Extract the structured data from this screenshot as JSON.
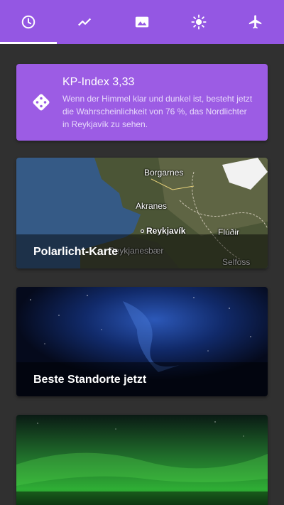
{
  "tabs": [
    {
      "name": "tab-now",
      "icon": "clock-icon",
      "selected": true
    },
    {
      "name": "tab-forecast",
      "icon": "trend-chart-icon",
      "selected": false
    },
    {
      "name": "tab-photos",
      "icon": "image-icon",
      "selected": false
    },
    {
      "name": "tab-sun",
      "icon": "sun-icon",
      "selected": false
    },
    {
      "name": "tab-travel",
      "icon": "airplane-icon",
      "selected": false
    }
  ],
  "kp_card": {
    "title": "KP-Index 3,33",
    "text": "Wenn der Himmel klar und dunkel ist, besteht jetzt die Wahrscheinlichkeit von 76 %, das Nordlichter in Reykjavík zu sehen.",
    "icon": "dice-icon"
  },
  "cards": {
    "map": {
      "label": "Polarlicht-Karte",
      "places": [
        "Borgarnes",
        "Akranes",
        "Reykjavík",
        "Flúðir",
        "Reykjanesbær",
        "Selfoss"
      ]
    },
    "stars": {
      "label": "Beste Standorte jetzt"
    },
    "green": {
      "label": ""
    }
  },
  "colors": {
    "accent": "#9457e3",
    "card_accent": "#9c5ce4",
    "background": "#303030"
  }
}
